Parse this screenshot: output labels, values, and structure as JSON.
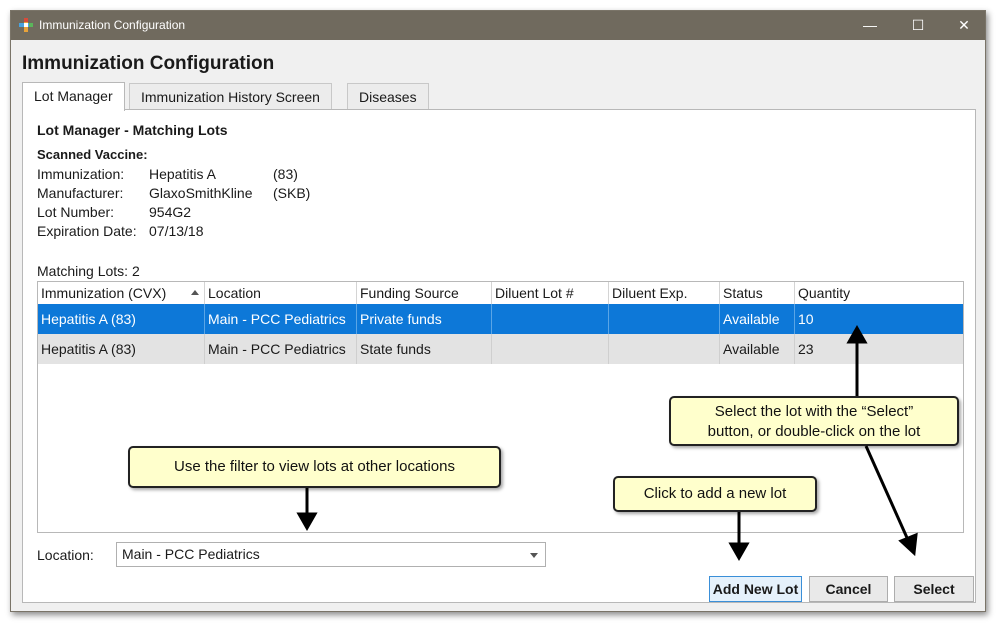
{
  "window": {
    "title": "Immunization Configuration",
    "controls": {
      "minimize": "—",
      "maximize": "☐",
      "close": "✕"
    }
  },
  "heading": "Immunization Configuration",
  "tabs": [
    {
      "label": "Lot Manager",
      "active": true
    },
    {
      "label": "Immunization History Screen",
      "active": false
    },
    {
      "label": "Diseases",
      "active": false
    }
  ],
  "lot_manager": {
    "subtitle": "Lot Manager - Matching Lots",
    "scanned_title": "Scanned Vaccine:",
    "fields": [
      {
        "label": "Immunization:",
        "value": "Hepatitis A",
        "code": "(83)"
      },
      {
        "label": "Manufacturer:",
        "value": "GlaxoSmithKline",
        "code": "(SKB)"
      },
      {
        "label": "Lot Number:",
        "value": "954G2",
        "code": ""
      },
      {
        "label": "Expiration Date:",
        "value": "07/13/18",
        "code": ""
      }
    ],
    "matching_label": "Matching Lots:",
    "matching_count": "2"
  },
  "table": {
    "columns": [
      "Immunization (CVX)",
      "Location",
      "Funding Source",
      "Diluent Lot #",
      "Diluent Exp.",
      "Status",
      "Quantity"
    ],
    "sorted_column": "Immunization (CVX)",
    "rows": [
      [
        "Hepatitis A (83)",
        "Main - PCC Pediatrics",
        "Private funds",
        "",
        "",
        "Available",
        "10"
      ],
      [
        "Hepatitis A (83)",
        "Main - PCC Pediatrics",
        "State funds",
        "",
        "",
        "Available",
        "23"
      ]
    ],
    "selected_row": 0
  },
  "location_filter": {
    "label": "Location:",
    "value": "Main - PCC Pediatrics"
  },
  "buttons": {
    "add_new_lot": "Add New Lot",
    "cancel": "Cancel",
    "select": "Select"
  },
  "callouts": {
    "select_hint_line1": "Select the lot with the “Select”",
    "select_hint_line2": "button, or double-click on the lot",
    "filter_hint": "Use the filter to view lots at other locations",
    "add_hint": "Click to add a new lot"
  },
  "colors": {
    "titlebar": "#706a5e",
    "selection": "#0d78d8",
    "callout_bg": "#ffffcc"
  }
}
